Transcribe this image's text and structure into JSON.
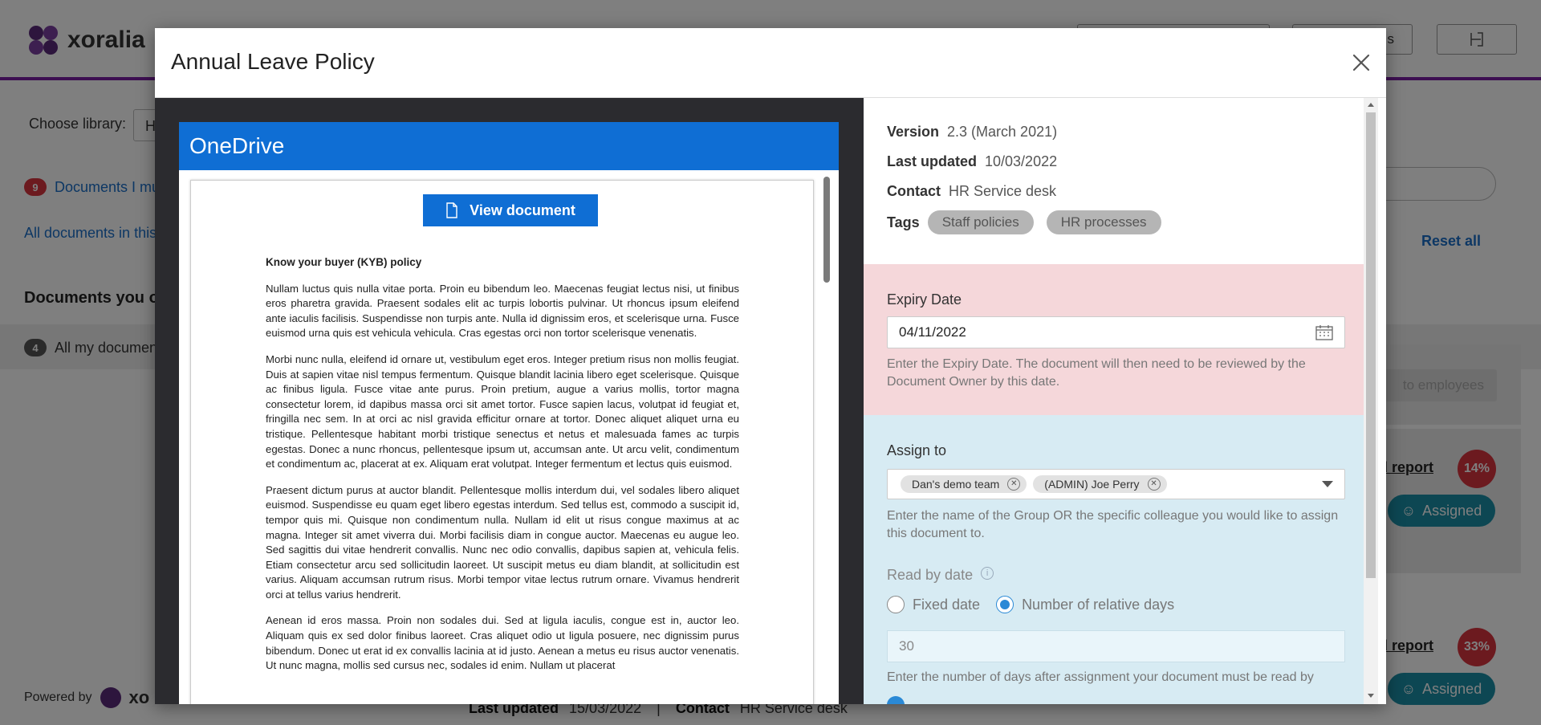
{
  "background": {
    "brand": "xoralia",
    "choose_library_label": "Choose library:",
    "choose_library_value": "H",
    "docs_must_read_count": "9",
    "docs_must_read_label": "Documents I mu",
    "all_docs_label": "All documents in this",
    "section_title": "Documents you ow",
    "all_my_docs_count": "4",
    "all_my_docs_label": "All my documen",
    "reset_all": "Reset all",
    "cta_label": "to employees",
    "read_report_label": "ad report",
    "rows": [
      {
        "pct": "14%",
        "assigned": "Assigned"
      },
      {
        "pct": "33%",
        "assigned": "Assigned"
      }
    ],
    "powered_by": "Powered by",
    "powered_brand": "xo",
    "footer_last_updated_label": "Last updated",
    "footer_last_updated_value": "15/03/2022",
    "footer_separator": "|",
    "footer_contact_label": "Contact",
    "footer_contact_value": "HR Service desk",
    "colors": {
      "accent": "#7b1fa2",
      "link": "#1a6fc9",
      "danger": "#d8343f",
      "teal": "#1b8ea6"
    }
  },
  "modal": {
    "title": "Annual Leave Policy",
    "preview": {
      "provider": "OneDrive",
      "view_button": "View document",
      "doc_heading": "Know your buyer (KYB) policy",
      "paragraphs": [
        "Nullam luctus quis nulla vitae porta. Proin eu bibendum leo. Maecenas feugiat lectus nisi, ut finibus eros pharetra gravida. Praesent sodales elit ac turpis lobortis pulvinar. Ut rhoncus ipsum eleifend ante iaculis facilisis. Suspendisse non turpis ante. Nulla id dignissim eros, et scelerisque urna. Fusce euismod urna quis est vehicula vehicula. Cras egestas orci non tortor scelerisque venenatis.",
        "Morbi nunc nulla, eleifend id ornare ut, vestibulum eget eros. Integer pretium risus non mollis feugiat. Duis at sapien vitae nisl tempus fermentum. Quisque blandit lacinia libero eget scelerisque. Quisque ac finibus ligula. Fusce vitae ante purus. Proin pretium, augue a varius mollis, tortor magna consectetur lorem, id dapibus massa orci sit amet tortor. Fusce sapien lacus, volutpat id feugiat et, fringilla nec sem. In at orci ac nisl gravida efficitur ornare at tortor. Donec aliquet aliquet urna eu tristique. Pellentesque habitant morbi tristique senectus et netus et malesuada fames ac turpis egestas. Donec a nunc rhoncus, pellentesque ipsum ut, accumsan ante. Ut arcu velit, condimentum et condimentum ac, placerat at ex. Aliquam erat volutpat. Integer fermentum et lectus quis euismod.",
        "Praesent dictum purus at auctor blandit. Pellentesque mollis interdum dui, vel sodales libero aliquet euismod. Suspendisse eu quam eget libero egestas interdum. Sed tellus est, commodo a suscipit id, tempor quis mi. Quisque non condimentum nulla. Nullam id elit ut risus congue maximus at ac magna. Integer sit amet viverra dui. Morbi facilisis diam in congue auctor. Maecenas eu augue leo. Sed sagittis dui vitae hendrerit convallis. Nunc nec odio convallis, dapibus sapien at, vehicula felis. Etiam consectetur arcu sed sollicitudin laoreet. Ut suscipit metus eu diam blandit, at sollicitudin est varius. Aliquam accumsan rutrum risus. Morbi tempor vitae lectus rutrum ornare. Vivamus hendrerit orci at tellus varius hendrerit.",
        "Aenean id eros massa. Proin non sodales dui. Sed at ligula iaculis, congue est in, auctor leo. Aliquam quis ex sed dolor finibus laoreet. Cras aliquet odio ut ligula posuere, nec dignissim purus bibendum. Donec ut erat id ex convallis lacinia at id justo. Aenean a metus eu risus auctor venenatis. Ut nunc magna, mollis sed cursus nec, sodales id enim. Nullam ut placerat"
      ]
    },
    "meta": {
      "version_label": "Version",
      "version_value": "2.3 (March 2021)",
      "last_updated_label": "Last updated",
      "last_updated_value": "10/03/2022",
      "contact_label": "Contact",
      "contact_value": "HR Service desk",
      "tags_label": "Tags",
      "tags": [
        "Staff policies",
        "HR processes"
      ]
    },
    "expiry": {
      "label": "Expiry Date",
      "value": "04/11/2022",
      "help": "Enter the Expiry Date. The document will then need to be reviewed by the Document Owner by this date."
    },
    "assign": {
      "label": "Assign to",
      "chips": [
        "Dan's demo team",
        "(ADMIN) Joe Perry"
      ],
      "help": "Enter the name of the Group OR the specific colleague you would like to assign this document to.",
      "read_by_label": "Read by date",
      "option_fixed": "Fixed date",
      "option_relative": "Number of relative days",
      "selected_option": "Number of relative days",
      "days_value": "30",
      "days_help": "Enter the number of days after assignment your document must be read by"
    }
  }
}
